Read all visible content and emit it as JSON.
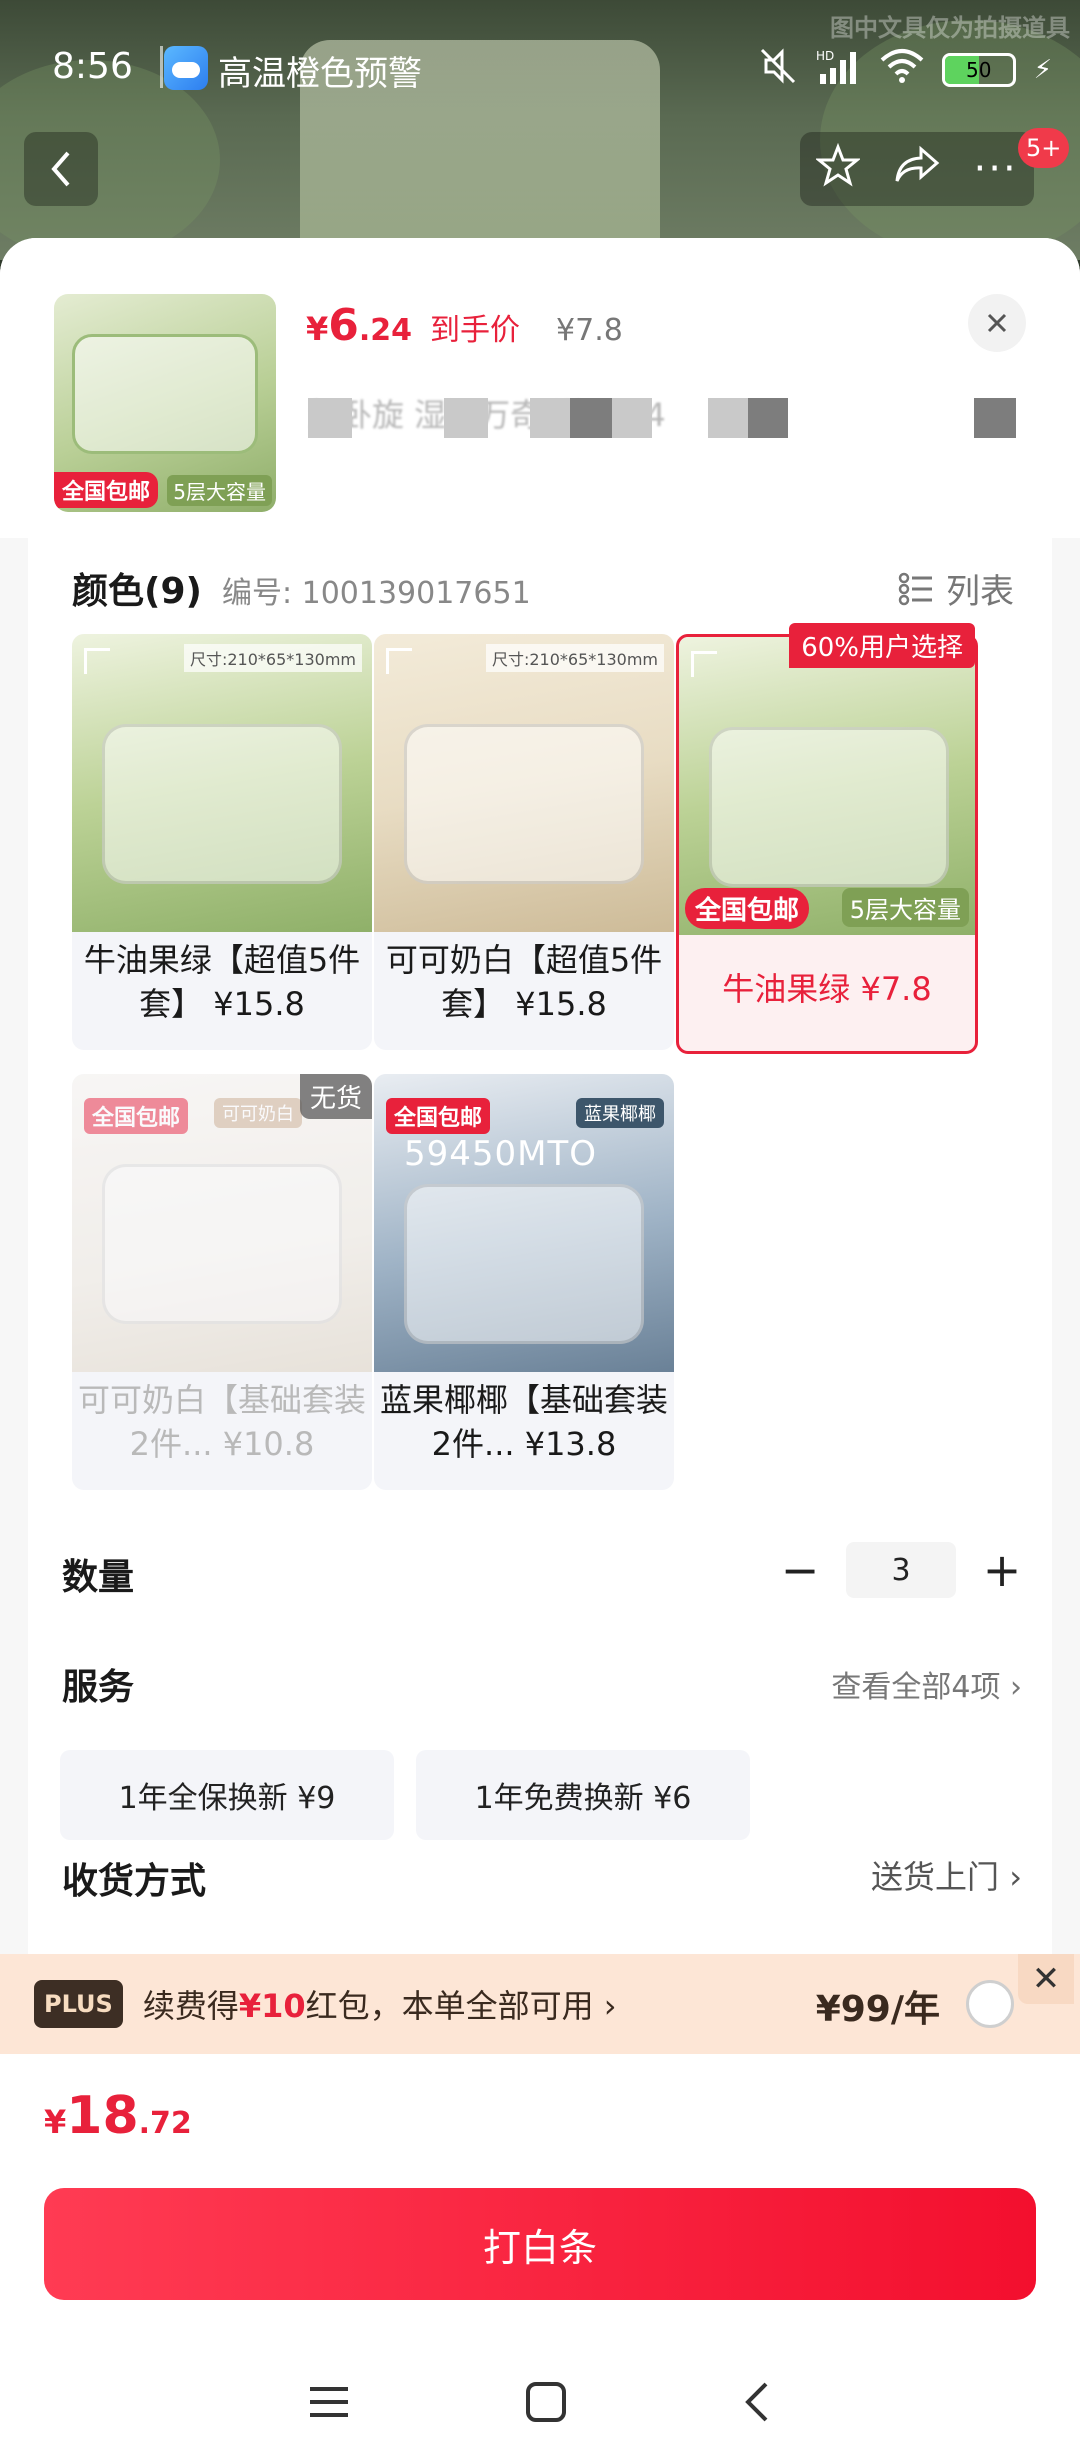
{
  "watermark": "图中文具仅为拍摄道具",
  "status_bar": {
    "time": "8:56",
    "alert": "高温橙色预警",
    "battery": "50",
    "network": "HD"
  },
  "nav": {
    "badge": "5+"
  },
  "product": {
    "price_currency": "¥",
    "price_int": "6",
    "price_dec": ".24",
    "price_label": "到手价",
    "original_price": "¥7.8",
    "thumb_promo": "全国包邮",
    "thumb_capacity": "5层大容量",
    "title_blurred": "超卧旋  湿沥万奇          送2424"
  },
  "color": {
    "title": "颜色(9)",
    "code": "编号: 100139017651",
    "list_label": "列表"
  },
  "skus": [
    {
      "label": "牛油果绿【超值5件套】 ¥15.8",
      "size": "尺寸:210*65*130mm"
    },
    {
      "label": "可可奶白【超值5件套】 ¥15.8",
      "size": "尺寸:210*65*130mm"
    },
    {
      "label": "牛油果绿 ¥7.8",
      "badge": "60%用户选择",
      "promo": "全国包邮",
      "capacity": "5层大容量"
    },
    {
      "label": "可可奶白【基础套装2件... ¥10.8",
      "badge": "无货",
      "promo": "全国包邮",
      "brand": "可可奶白"
    },
    {
      "label": "蓝果椰椰【基础套装2件... ¥13.8",
      "promo": "全国包邮",
      "brand": "蓝果椰椰",
      "code": "59450MTO"
    }
  ],
  "quantity": {
    "title": "数量",
    "value": "3",
    "minus": "−",
    "plus": "+"
  },
  "service": {
    "title": "服务",
    "more": "查看全部4项 ›",
    "options": [
      {
        "label": "1年全保换新  ¥9"
      },
      {
        "label": "1年免费换新  ¥6"
      }
    ]
  },
  "shipping": {
    "title": "收货方式",
    "value": "送货上门 ›"
  },
  "plus_banner": {
    "tag": "PLUS",
    "text_pre": "续费得",
    "text_hl": "¥10",
    "text_post": "红包，本单全部可用 ›",
    "price": "¥99/年",
    "close": "✕"
  },
  "total": {
    "currency": "¥",
    "int": "18",
    "dec": ".72"
  },
  "pay_button": "打白条",
  "colors": {
    "accent": "#e8213b",
    "plus_bg": "#fde6d6"
  }
}
